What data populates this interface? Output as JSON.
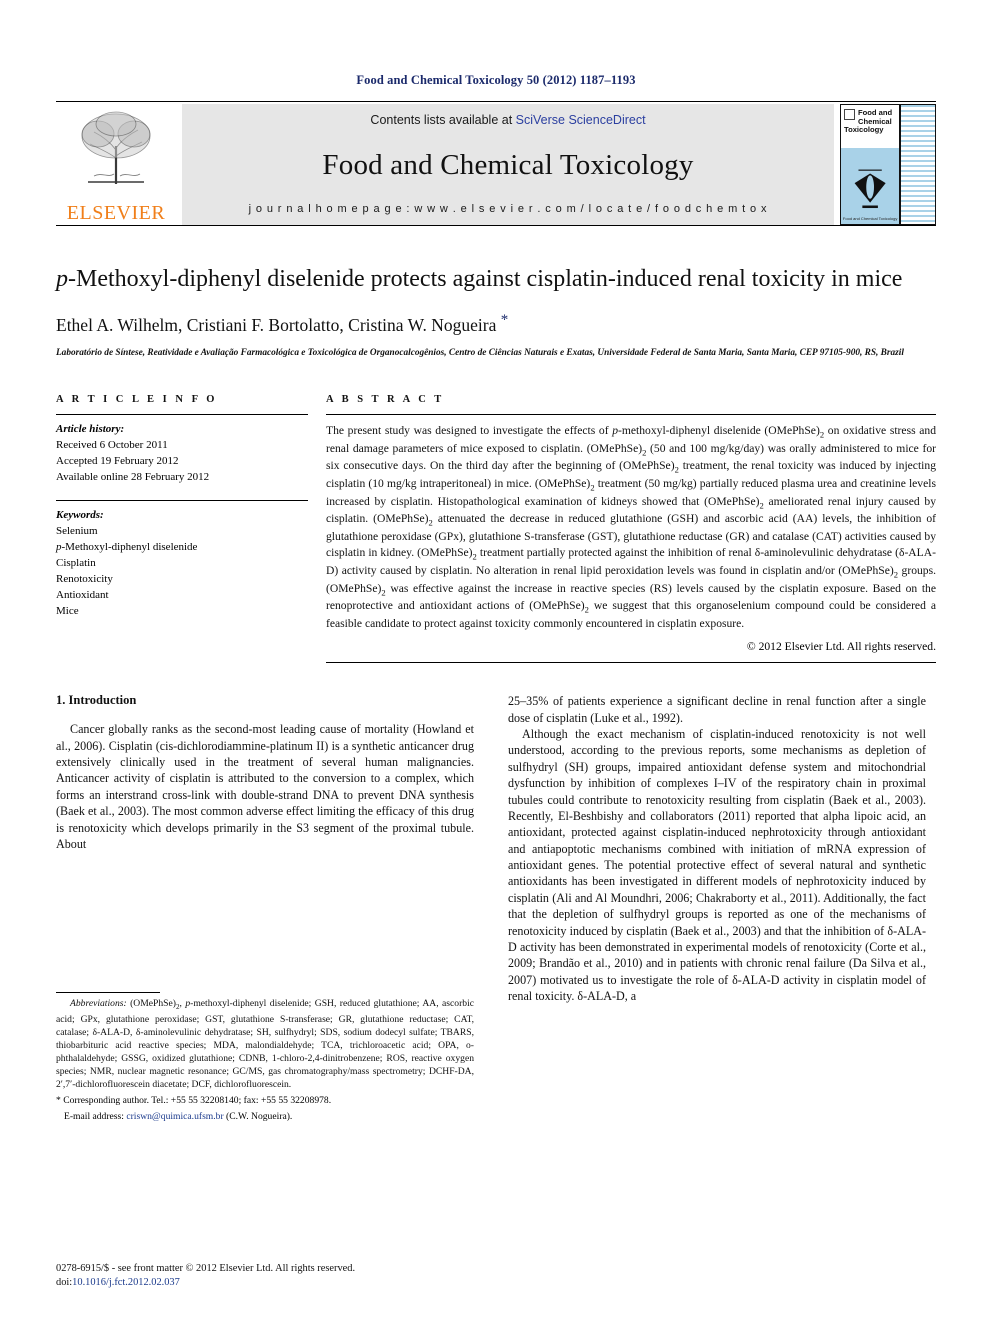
{
  "running_head": "Food and Chemical Toxicology 50 (2012) 1187–1193",
  "masthead": {
    "publisher": "ELSEVIER",
    "contents_prefix": "Contents lists available at ",
    "contents_link": "SciVerse ScienceDirect",
    "journal_title": "Food and Chemical Toxicology",
    "homepage": "j o u r n a l   h o m e p a g e :   w w w . e l s e v i e r . c o m / l o c a t e / f o o d c h e m t o x",
    "cover_line1": "Food and",
    "cover_line2": "Chemical",
    "cover_line3": "Toxicology",
    "cover_caption": "Food and Chemical Toxicology"
  },
  "article": {
    "title_italic_lead": "p",
    "title_rest": "-Methoxyl-diphenyl diselenide protects against cisplatin-induced renal toxicity in mice",
    "authors": "Ethel A. Wilhelm, Cristiani F. Bortolatto, Cristina W. Nogueira",
    "author_star": "*",
    "affiliation": "Laboratório de Síntese, Reatividade e Avaliação Farmacológica e Toxicológica de Organocalcogênios, Centro de Ciências Naturais e Exatas, Universidade Federal de Santa Maria, Santa Maria, CEP 97105-900, RS, Brazil"
  },
  "info": {
    "heading": "A R T I C L E    I N F O",
    "history_label": "Article history:",
    "received": "Received 6 October 2011",
    "accepted": "Accepted 19 February 2012",
    "available": "Available online 28 February 2012",
    "keywords_label": "Keywords:",
    "keywords": [
      "Selenium",
      "p-Methoxyl-diphenyl diselenide",
      "Cisplatin",
      "Renotoxicity",
      "Antioxidant",
      "Mice"
    ]
  },
  "abstract": {
    "heading": "A B S T R A C T",
    "text": "The present study was designed to investigate the effects of p-methoxyl-diphenyl diselenide (OMePhSe)2 on oxidative stress and renal damage parameters of mice exposed to cisplatin. (OMePhSe)2 (50 and 100 mg/kg/day) was orally administered to mice for six consecutive days. On the third day after the beginning of (OMePhSe)2 treatment, the renal toxicity was induced by injecting cisplatin (10 mg/kg intraperitoneal) in mice. (OMePhSe)2 treatment (50 mg/kg) partially reduced plasma urea and creatinine levels increased by cisplatin. Histopathological examination of kidneys showed that (OMePhSe)2 ameliorated renal injury caused by cisplatin. (OMePhSe)2 attenuated the decrease in reduced glutathione (GSH) and ascorbic acid (AA) levels, the inhibition of glutathione peroxidase (GPx), glutathione S-transferase (GST), glutathione reductase (GR) and catalase (CAT) activities caused by cisplatin in kidney. (OMePhSe)2 treatment partially protected against the inhibition of renal δ-aminolevulinic dehydratase (δ-ALA-D) activity caused by cisplatin. No alteration in renal lipid peroxidation levels was found in cisplatin and/or (OMePhSe)2 groups. (OMePhSe)2 was effective against the increase in reactive species (RS) levels caused by the cisplatin exposure. Based on the renoprotective and antioxidant actions of (OMePhSe)2 we suggest that this organoselenium compound could be considered a feasible candidate to protect against toxicity commonly encountered in cisplatin exposure.",
    "copyright": "© 2012 Elsevier Ltd. All rights reserved."
  },
  "introduction": {
    "heading": "1. Introduction",
    "left_para_1": "Cancer globally ranks as the second-most leading cause of mortality (Howland et al., 2006). Cisplatin (cis-dichlorodiammine-platinum II) is a synthetic anticancer drug extensively clinically used in the treatment of several human malignancies. Anticancer activity of cisplatin is attributed to the conversion to a complex, which forms an interstrand cross-link with double-strand DNA to prevent DNA synthesis (Baek et al., 2003). The most common adverse effect limiting the efficacy of this drug is renotoxicity which develops primarily in the S3 segment of the proximal tubule. About",
    "right_para_1": "25–35% of patients experience a significant decline in renal function after a single dose of cisplatin (Luke et al., 1992).",
    "right_para_2": "Although the exact mechanism of cisplatin-induced renotoxicity is not well understood, according to the previous reports, some mechanisms as depletion of sulfhydryl (SH) groups, impaired antioxidant defense system and mitochondrial dysfunction by inhibition of complexes I–IV of the respiratory chain in proximal tubules could contribute to renotoxicity resulting from cisplatin (Baek et al., 2003). Recently, El-Beshbishy and collaborators (2011) reported that alpha lipoic acid, an antioxidant, protected against cisplatin-induced nephrotoxicity through antioxidant and antiapoptotic mechanisms combined with initiation of mRNA expression of antioxidant genes. The potential protective effect of several natural and synthetic antioxidants has been investigated in different models of nephrotoxicity induced by cisplatin (Ali and Al Moundhri, 2006; Chakraborty et al., 2011). Additionally, the fact that the depletion of sulfhydryl groups is reported as one of the mechanisms of renotoxicity induced by cisplatin (Baek et al., 2003) and that the inhibition of δ-ALA-D activity has been demonstrated in experimental models of renotoxicity (Corte et al., 2009; Brandão et al., 2010) and in patients with chronic renal failure (Da Silva et al., 2007) motivated us to investigate the role of δ-ALA-D activity in cisplatin model of renal toxicity. δ-ALA-D, a"
  },
  "footnotes": {
    "abbrev_label": "Abbreviations:",
    "abbrev_text": " (OMePhSe)2, p-methoxyl-diphenyl diselenide; GSH, reduced glutathione; AA, ascorbic acid; GPx, glutathione peroxidase; GST, glutathione S-transferase; GR, glutathione reductase; CAT, catalase; δ-ALA-D, δ-aminolevulinic dehydratase; SH, sulfhydryl; SDS, sodium dodecyl sulfate; TBARS, thiobarbituric acid reactive species; MDA, malondialdehyde; TCA, trichloroacetic acid; OPA, o-phthalaldehyde; GSSG, oxidized glutathione; CDNB, 1-chloro-2,4-dinitrobenzene; ROS, reactive oxygen species; NMR, nuclear magnetic resonance; GC/MS, gas chromatography/mass spectrometry; DCHF-DA, 2′,7′-dichlorofluorescein diacetate; DCF, dichlorofluorescein.",
    "corresponding": "* Corresponding author. Tel.: +55 55 32208140; fax: +55 55 32208978.",
    "email_label": "E-mail address:",
    "email": "criswn@quimica.ufsm.br",
    "email_suffix": " (C.W. Nogueira)."
  },
  "page_footer": {
    "issn_line": "0278-6915/$ - see front matter © 2012 Elsevier Ltd. All rights reserved.",
    "doi_label": "doi:",
    "doi_value": "10.1016/j.fct.2012.02.037"
  },
  "colors": {
    "link_blue": "#1b3a8c",
    "header_blue": "#1b2a6b",
    "elsevier_orange": "#f07f1a",
    "masthead_grey": "#e6e6e6",
    "cover_blue": "#a9d2e8"
  }
}
